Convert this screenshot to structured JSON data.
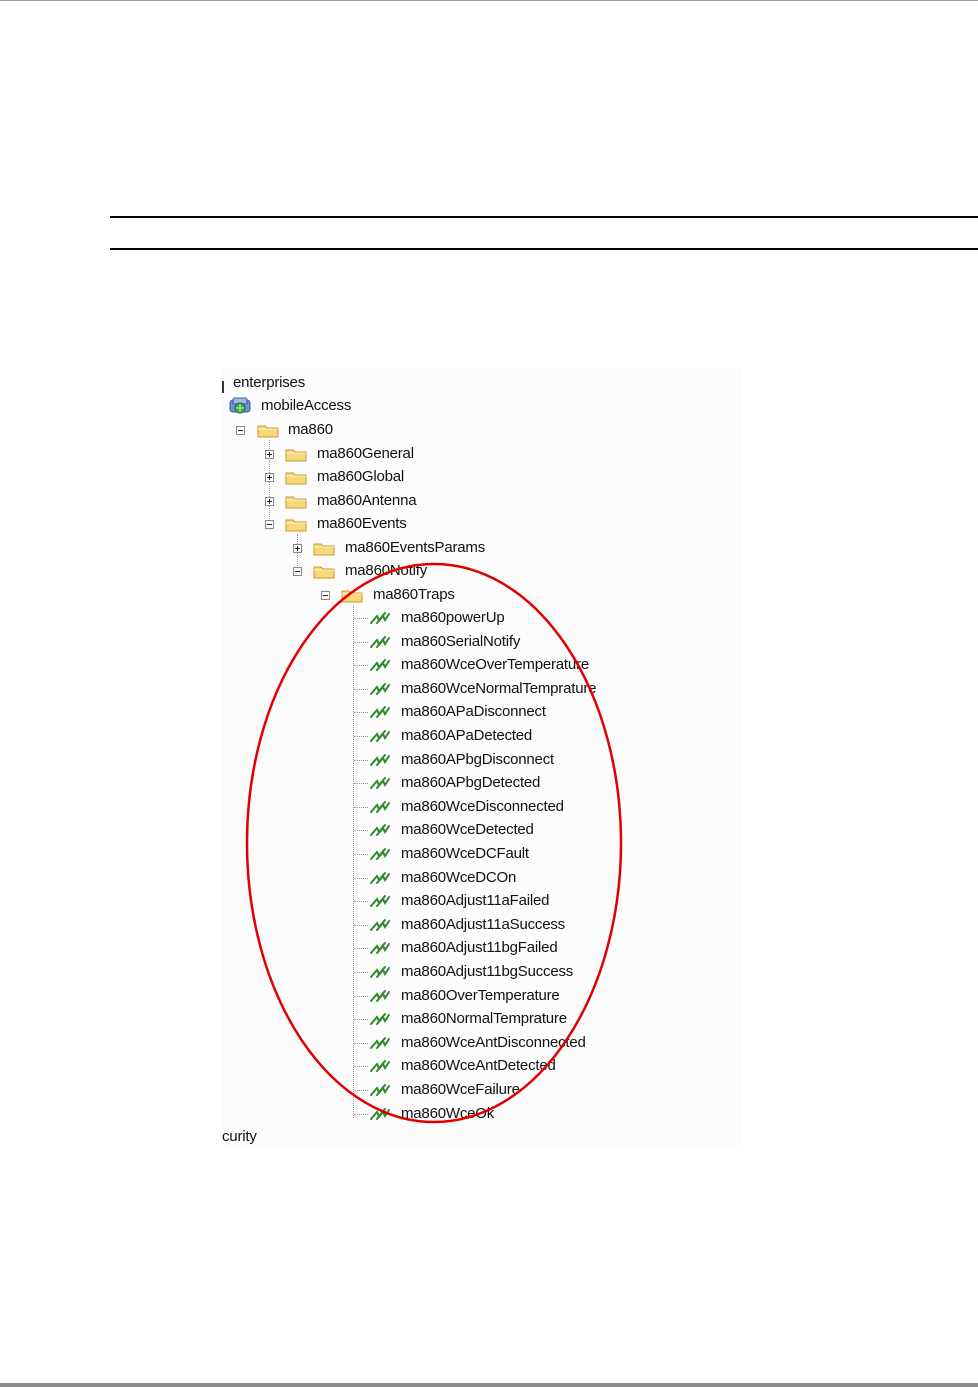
{
  "tree": {
    "root": {
      "label": "enterprises"
    },
    "mobile_access": {
      "label": "mobileAccess",
      "icon": "network-globe-icon"
    },
    "ma860": {
      "label": "ma860",
      "expanded": true
    },
    "groups": [
      {
        "label": "ma860General",
        "expanded": false
      },
      {
        "label": "ma860Global",
        "expanded": false
      },
      {
        "label": "ma860Antenna",
        "expanded": false
      },
      {
        "label": "ma860Events",
        "expanded": true
      }
    ],
    "events_children": [
      {
        "label": "ma860EventsParams",
        "expanded": false
      },
      {
        "label": "ma860Notify",
        "expanded": true
      }
    ],
    "traps_folder": {
      "label": "ma860Traps",
      "expanded": true
    },
    "traps": [
      "ma860powerUp",
      "ma860SerialNotify",
      "ma860WceOverTemperature",
      "ma860WceNormalTemprature",
      "ma860APaDisconnect",
      "ma860APaDetected",
      "ma860APbgDisconnect",
      "ma860APbgDetected",
      "ma860WceDisconnected",
      "ma860WceDetected",
      "ma860WceDCFault",
      "ma860WceDCOn",
      "ma860Adjust11aFailed",
      "ma860Adjust11aSuccess",
      "ma860Adjust11bgFailed",
      "ma860Adjust11bgSuccess",
      "ma860OverTemperature",
      "ma860NormalTemprature",
      "ma860WceAntDisconnected",
      "ma860WceAntDetected",
      "ma860WceFailure",
      "ma860WceOk"
    ],
    "bottom_partial": {
      "label": "curity"
    }
  },
  "colors": {
    "highlight": "#e00000",
    "folder_fill": "#f7d87a",
    "folder_edge": "#c99a2e",
    "trap_icon": "#2f8a2f"
  }
}
